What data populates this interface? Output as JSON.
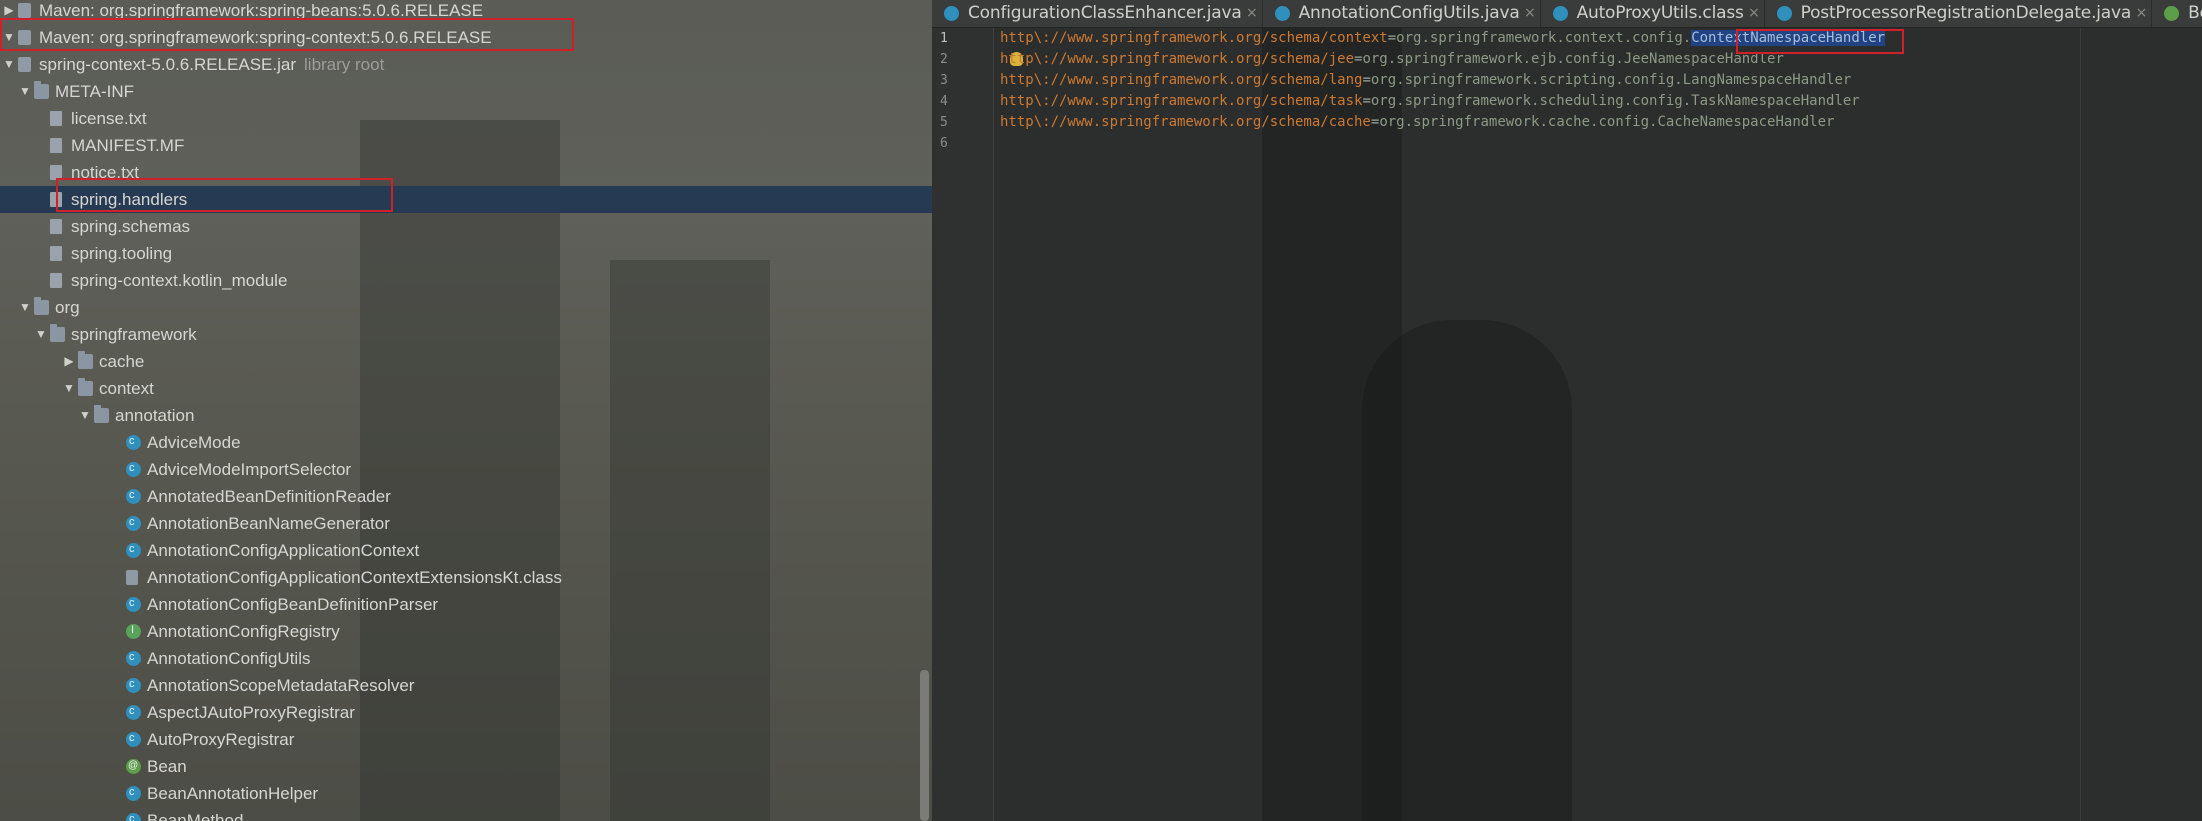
{
  "tree": {
    "rows": [
      {
        "label": "Maven: org.springframework:spring-beans:5.0.6.RELEASE",
        "dim": "",
        "icon": "library-icon",
        "toggle": "right",
        "depth": 0
      },
      {
        "label": "Maven: org.springframework:spring-context:5.0.6.RELEASE",
        "dim": "",
        "icon": "library-icon",
        "toggle": "down",
        "depth": 0
      },
      {
        "label": "spring-context-5.0.6.RELEASE.jar",
        "dim": "library root",
        "icon": "jar-icon",
        "toggle": "down",
        "depth": 1
      },
      {
        "label": "META-INF",
        "dim": "",
        "icon": "folder-icon",
        "toggle": "down",
        "depth": 2
      },
      {
        "label": "license.txt",
        "dim": "",
        "icon": "file-icon",
        "toggle": "",
        "depth": 3
      },
      {
        "label": "MANIFEST.MF",
        "dim": "",
        "icon": "file-icon",
        "toggle": "",
        "depth": 3
      },
      {
        "label": "notice.txt",
        "dim": "",
        "icon": "file-icon",
        "toggle": "",
        "depth": 3
      },
      {
        "label": "spring.handlers",
        "dim": "",
        "icon": "file-icon",
        "toggle": "",
        "depth": 3,
        "selected": true
      },
      {
        "label": "spring.schemas",
        "dim": "",
        "icon": "file-icon",
        "toggle": "",
        "depth": 3
      },
      {
        "label": "spring.tooling",
        "dim": "",
        "icon": "file-icon",
        "toggle": "",
        "depth": 3
      },
      {
        "label": "spring-context.kotlin_module",
        "dim": "",
        "icon": "file-icon",
        "toggle": "",
        "depth": 3
      },
      {
        "label": "org",
        "dim": "",
        "icon": "package-icon",
        "toggle": "down",
        "depth": 2
      },
      {
        "label": "springframework",
        "dim": "",
        "icon": "package-icon",
        "toggle": "down",
        "depth": 3
      },
      {
        "label": "cache",
        "dim": "",
        "icon": "package-icon",
        "toggle": "right",
        "depth": 4
      },
      {
        "label": "context",
        "dim": "",
        "icon": "package-icon",
        "toggle": "down",
        "depth": 4
      },
      {
        "label": "annotation",
        "dim": "",
        "icon": "package-icon",
        "toggle": "down",
        "depth": 5
      },
      {
        "label": "AdviceMode",
        "dim": "",
        "icon": "class-icon",
        "toggle": "",
        "depth": 6
      },
      {
        "label": "AdviceModeImportSelector",
        "dim": "",
        "icon": "class-icon",
        "toggle": "",
        "depth": 6
      },
      {
        "label": "AnnotatedBeanDefinitionReader",
        "dim": "",
        "icon": "class-icon",
        "toggle": "",
        "depth": 6
      },
      {
        "label": "AnnotationBeanNameGenerator",
        "dim": "",
        "icon": "class-icon",
        "toggle": "",
        "depth": 6
      },
      {
        "label": "AnnotationConfigApplicationContext",
        "dim": "",
        "icon": "class-icon",
        "toggle": "",
        "depth": 6
      },
      {
        "label": "AnnotationConfigApplicationContextExtensionsKt.class",
        "dim": "",
        "icon": "kotlin-file-icon",
        "toggle": "",
        "depth": 6
      },
      {
        "label": "AnnotationConfigBeanDefinitionParser",
        "dim": "",
        "icon": "class-icon",
        "toggle": "",
        "depth": 6
      },
      {
        "label": "AnnotationConfigRegistry",
        "dim": "",
        "icon": "interface-icon",
        "toggle": "",
        "depth": 6
      },
      {
        "label": "AnnotationConfigUtils",
        "dim": "",
        "icon": "class-icon",
        "toggle": "",
        "depth": 6
      },
      {
        "label": "AnnotationScopeMetadataResolver",
        "dim": "",
        "icon": "class-icon",
        "toggle": "",
        "depth": 6
      },
      {
        "label": "AspectJAutoProxyRegistrar",
        "dim": "",
        "icon": "class-icon",
        "toggle": "",
        "depth": 6
      },
      {
        "label": "AutoProxyRegistrar",
        "dim": "",
        "icon": "class-icon",
        "toggle": "",
        "depth": 6
      },
      {
        "label": "Bean",
        "dim": "",
        "icon": "annotation-icon",
        "toggle": "",
        "depth": 6
      },
      {
        "label": "BeanAnnotationHelper",
        "dim": "",
        "icon": "class-icon",
        "toggle": "",
        "depth": 6
      },
      {
        "label": "BeanMethod",
        "dim": "",
        "icon": "class-icon",
        "toggle": "",
        "depth": 6
      }
    ]
  },
  "editor": {
    "tabs": [
      {
        "label": "ConfigurationClassEnhancer.java",
        "icon": "class-icon"
      },
      {
        "label": "AnnotationConfigUtils.java",
        "icon": "class-icon"
      },
      {
        "label": "AutoProxyUtils.class",
        "icon": "class-icon"
      },
      {
        "label": "PostProcessorRegistrationDelegate.java",
        "icon": "class-icon"
      },
      {
        "label": "BeanDefi",
        "icon": "class-icon"
      }
    ],
    "line_numbers": [
      "1",
      "2",
      "3",
      "4",
      "5",
      "6"
    ],
    "lines": [
      {
        "key": "http\\://www.springframework.org/schema/context",
        "sep": "=",
        "value": "org.springframework.context.config.",
        "selected": "ContextNamespaceHandler"
      },
      {
        "key": "http\\://www.springframework.org/schema/jee",
        "sep": "=",
        "value": "org.springframework.ejb.config.JeeNamespaceHandler",
        "selected": ""
      },
      {
        "key": "http\\://www.springframework.org/schema/lang",
        "sep": "=",
        "value": "org.springframework.scripting.config.LangNamespaceHandler",
        "selected": ""
      },
      {
        "key": "http\\://www.springframework.org/schema/task",
        "sep": "=",
        "value": "org.springframework.scheduling.config.TaskNamespaceHandler",
        "selected": ""
      },
      {
        "key": "http\\://www.springframework.org/schema/cache",
        "sep": "=",
        "value": "org.springframework.cache.config.CacheNamespaceHandler",
        "selected": ""
      },
      {
        "key": "",
        "sep": "",
        "value": "",
        "selected": ""
      }
    ]
  },
  "colors": {
    "selection": "#263a53",
    "highlight_box": "#d0202a",
    "property_key": "#cc7a32",
    "property_value": "#8d9a84"
  }
}
